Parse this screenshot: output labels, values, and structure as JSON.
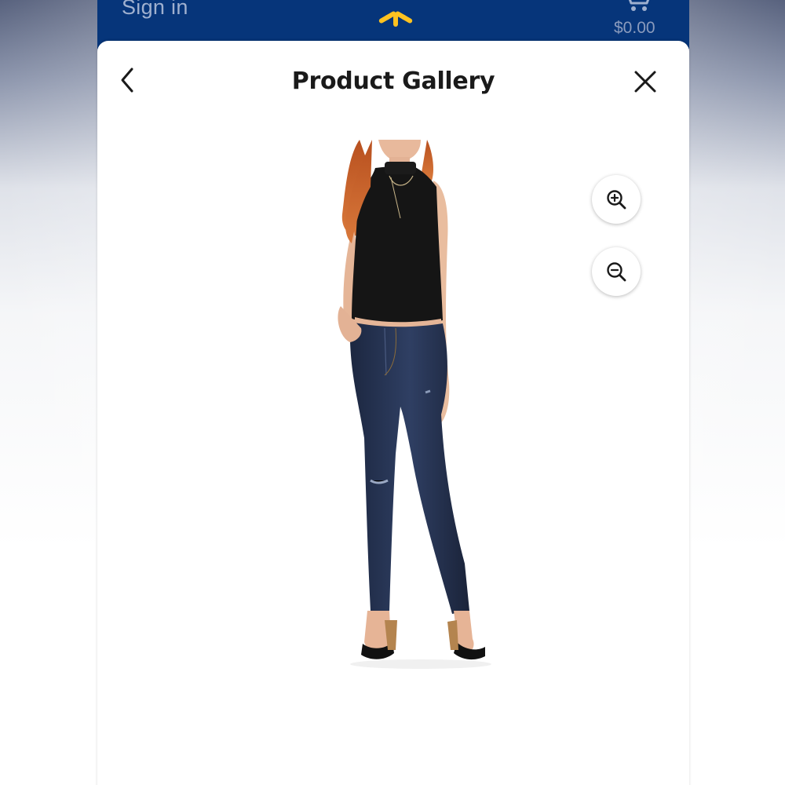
{
  "header": {
    "sign_in_label": "Sign in",
    "cart_total": "$0.00",
    "logo_icon": "walmart-spark-icon",
    "cart_icon": "cart-icon",
    "brand_color": "#06357a",
    "spark_color": "#ffc220"
  },
  "gallery": {
    "title": "Product Gallery",
    "back_icon": "chevron-left-icon",
    "close_icon": "close-icon",
    "zoom_in_icon": "zoom-in-icon",
    "zoom_out_icon": "zoom-out-icon",
    "image_subject": "model wearing black sleeveless mock-neck top and dark wash distressed skinny jeans with black sandals"
  }
}
